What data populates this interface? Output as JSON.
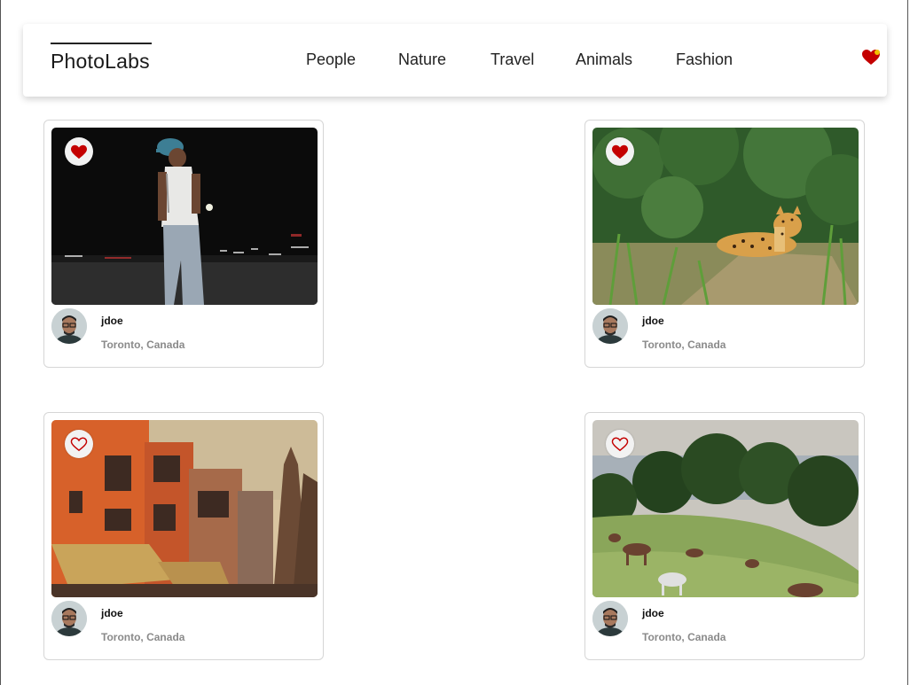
{
  "app": {
    "brand": "PhotoLabs"
  },
  "nav": {
    "topics": [
      "People",
      "Nature",
      "Travel",
      "Animals",
      "Fashion"
    ]
  },
  "favourites": {
    "icon": "heart-icon",
    "has_notification": true,
    "color": "#c40000"
  },
  "photos": [
    {
      "subject": "man-in-cap-at-night",
      "liked": true,
      "user": {
        "username": "jdoe",
        "location": "Toronto, Canada"
      }
    },
    {
      "subject": "jaguar-in-grass",
      "liked": true,
      "user": {
        "username": "jdoe",
        "location": "Toronto, Canada"
      }
    },
    {
      "subject": "orange-buildings-street",
      "liked": false,
      "user": {
        "username": "jdoe",
        "location": "Toronto, Canada"
      }
    },
    {
      "subject": "horses-grazing-hillside",
      "liked": false,
      "user": {
        "username": "jdoe",
        "location": "Toronto, Canada"
      }
    }
  ],
  "colors": {
    "like_red": "#c40000",
    "muted_text": "#8a8a8a"
  }
}
